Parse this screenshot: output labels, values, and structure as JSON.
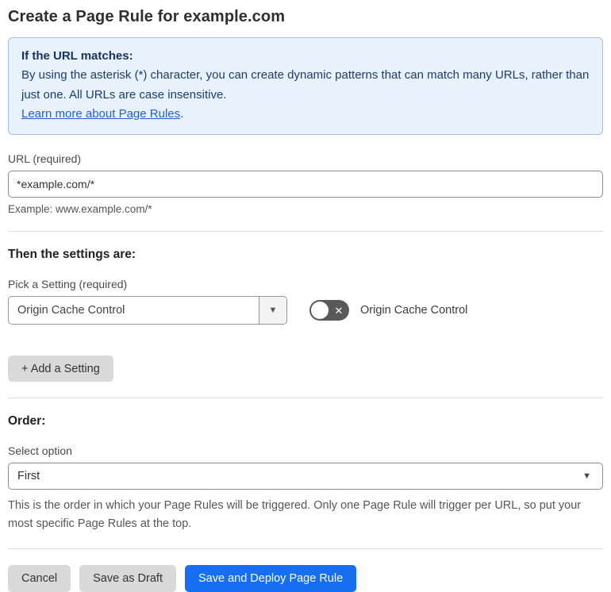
{
  "page": {
    "title": "Create a Page Rule for example.com"
  },
  "info_box": {
    "heading": "If the URL matches:",
    "body": "By using the asterisk (*) character, you can create dynamic patterns that can match many URLs, rather than just one. All URLs are case insensitive.",
    "link_label": "Learn more about Page Rules",
    "link_suffix": "."
  },
  "url_section": {
    "label": "URL (required)",
    "value": "*example.com/*",
    "example": "Example: www.example.com/*"
  },
  "settings_section": {
    "heading": "Then the settings are:",
    "picker_label": "Pick a Setting (required)",
    "selected_setting": "Origin Cache Control",
    "picker_arrow": "▼",
    "toggle_label": "Origin Cache Control",
    "toggle_state": "off",
    "toggle_glyph": "✕",
    "add_setting_label": "+ Add a Setting"
  },
  "order_section": {
    "heading": "Order:",
    "select_label": "Select option",
    "selected_option": "First",
    "caret": "▼",
    "help_text": "This is the order in which your Page Rules will be triggered. Only one Page Rule will trigger per URL, so put your most specific Page Rules at the top."
  },
  "footer": {
    "cancel_label": "Cancel",
    "save_draft_label": "Save as Draft",
    "save_deploy_label": "Save and Deploy Page Rule"
  },
  "colors": {
    "accent_blue": "#156ff0",
    "info_background": "#e8f2fc",
    "info_border": "#9cc2e8",
    "info_text": "#16325c",
    "link_blue": "#2160d3",
    "toggle_off_gray": "#595959",
    "button_gray": "#d9d9d9"
  }
}
